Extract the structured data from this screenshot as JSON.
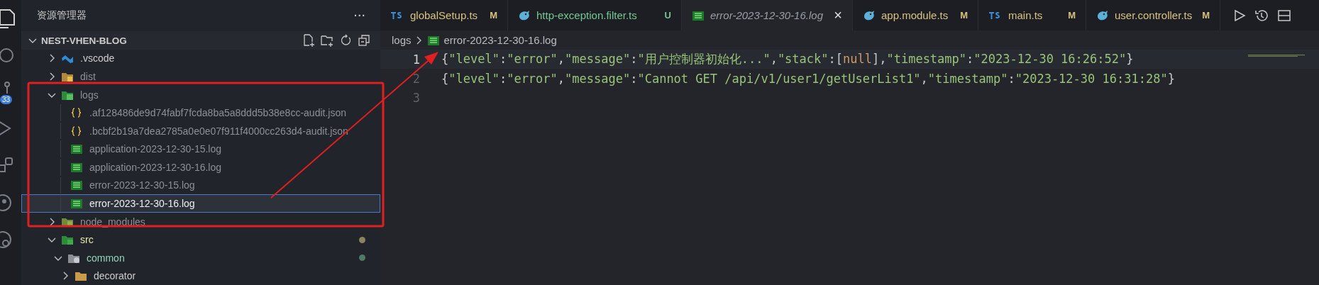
{
  "activity_bar": {
    "items": [
      {
        "kind": "explorer",
        "selected": true
      },
      {
        "kind": "search",
        "selected": false
      },
      {
        "kind": "source-control",
        "selected": false,
        "badge": "33"
      },
      {
        "kind": "run",
        "selected": false
      },
      {
        "kind": "extensions",
        "selected": false
      },
      {
        "kind": "remote",
        "selected": false
      },
      {
        "kind": "accounts",
        "selected": false
      }
    ]
  },
  "sidebar": {
    "title": "资源管理器",
    "more": "···",
    "section": {
      "title": "NEST-VHEN-BLOG",
      "expanded": true
    },
    "tree": [
      {
        "name": ".vscode",
        "kind": "vscode",
        "expanded": false,
        "selected": false,
        "ignored": false
      },
      {
        "name": "dist",
        "kind": "folder-dist",
        "expanded": false,
        "selected": false,
        "ignored": true
      },
      {
        "name": "logs",
        "kind": "folder-logs",
        "expanded": true,
        "selected": false,
        "ignored": true,
        "children": [
          {
            "name": ".af128486de9d74fabf7fcda8ba5a8ddd5b38e8cc-audit.json",
            "kind": "json",
            "selected": false,
            "ignored": true
          },
          {
            "name": ".bcbf2b19a7dea2785a0e0e07f911f4000cc263d4-audit.json",
            "kind": "json",
            "selected": false,
            "ignored": true
          },
          {
            "name": "application-2023-12-30-15.log",
            "kind": "log",
            "selected": false,
            "ignored": true
          },
          {
            "name": "application-2023-12-30-16.log",
            "kind": "log",
            "selected": false,
            "ignored": true
          },
          {
            "name": "error-2023-12-30-15.log",
            "kind": "log",
            "selected": false,
            "ignored": true
          },
          {
            "name": "error-2023-12-30-16.log",
            "kind": "log",
            "selected": true,
            "ignored": true
          }
        ]
      },
      {
        "name": "node_modules",
        "kind": "folder-node",
        "expanded": false,
        "selected": false,
        "ignored": true
      },
      {
        "name": "src",
        "kind": "folder-src",
        "expanded": true,
        "selected": false,
        "ignored": false,
        "color": "#8a8560",
        "children": [
          {
            "name": "common",
            "kind": "folder-common",
            "expanded": true,
            "selected": false,
            "ignored": false,
            "color": "#4e7a66",
            "children": [
              {
                "name": "decorator",
                "kind": "folder",
                "expanded": false,
                "selected": false,
                "ignored": false
              }
            ]
          }
        ]
      }
    ]
  },
  "tabs": [
    {
      "label": "globalSetup.ts",
      "kind": "ts",
      "badge": "M",
      "color": "#d7c27e",
      "selected": false,
      "preview": false
    },
    {
      "label": "http-exception.filter.ts",
      "kind": "nest",
      "badge": "U",
      "color": "#73c991",
      "selected": false,
      "preview": false
    },
    {
      "label": "error-2023-12-30-16.log",
      "kind": "log",
      "selected": true,
      "preview": true,
      "close": "×"
    },
    {
      "label": "app.module.ts",
      "kind": "nest",
      "badge": "M",
      "color": "#d7c27e",
      "selected": false,
      "preview": false
    },
    {
      "label": "main.ts",
      "kind": "ts",
      "badge": "M",
      "color": "#d7c27e",
      "selected": false,
      "preview": false
    },
    {
      "label": "user.controller.ts",
      "kind": "nest",
      "badge": "M",
      "color": "#d7c27e",
      "selected": false,
      "preview": false
    }
  ],
  "breadcrumb": {
    "folder": "logs",
    "file": "error-2023-12-30-16.log"
  },
  "editor": {
    "lines": [
      {
        "number": "1",
        "current": true,
        "tokens": [
          {
            "text": "{",
            "kind": "punct"
          },
          {
            "text": "\"level\"",
            "kind": "string"
          },
          {
            "text": ":",
            "kind": "punct"
          },
          {
            "text": "\"error\"",
            "kind": "string"
          },
          {
            "text": ",",
            "kind": "punct"
          },
          {
            "text": "\"message\"",
            "kind": "string"
          },
          {
            "text": ":",
            "kind": "punct"
          },
          {
            "text": "\"用户控制器初始化...\"",
            "kind": "string"
          },
          {
            "text": ",",
            "kind": "punct"
          },
          {
            "text": "\"stack\"",
            "kind": "string"
          },
          {
            "text": ":[",
            "kind": "punct"
          },
          {
            "text": "null",
            "kind": "keyword"
          },
          {
            "text": "],",
            "kind": "punct"
          },
          {
            "text": "\"timestamp\"",
            "kind": "string"
          },
          {
            "text": ":",
            "kind": "punct"
          },
          {
            "text": "\"2023-12-30 16:26:52\"",
            "kind": "string"
          },
          {
            "text": "}",
            "kind": "punct"
          }
        ]
      },
      {
        "number": "2",
        "current": false,
        "tokens": [
          {
            "text": "{",
            "kind": "punct"
          },
          {
            "text": "\"level\"",
            "kind": "string"
          },
          {
            "text": ":",
            "kind": "punct"
          },
          {
            "text": "\"error\"",
            "kind": "string"
          },
          {
            "text": ",",
            "kind": "punct"
          },
          {
            "text": "\"message\"",
            "kind": "string"
          },
          {
            "text": ":",
            "kind": "punct"
          },
          {
            "text": "\"Cannot GET /api/v1/user1/getUserList1\"",
            "kind": "string"
          },
          {
            "text": ",",
            "kind": "punct"
          },
          {
            "text": "\"timestamp\"",
            "kind": "string"
          },
          {
            "text": ":",
            "kind": "punct"
          },
          {
            "text": "\"2023-12-30 16:31:28\"",
            "kind": "string"
          },
          {
            "text": "}",
            "kind": "punct"
          }
        ]
      },
      {
        "number": "3",
        "current": false
      }
    ]
  }
}
